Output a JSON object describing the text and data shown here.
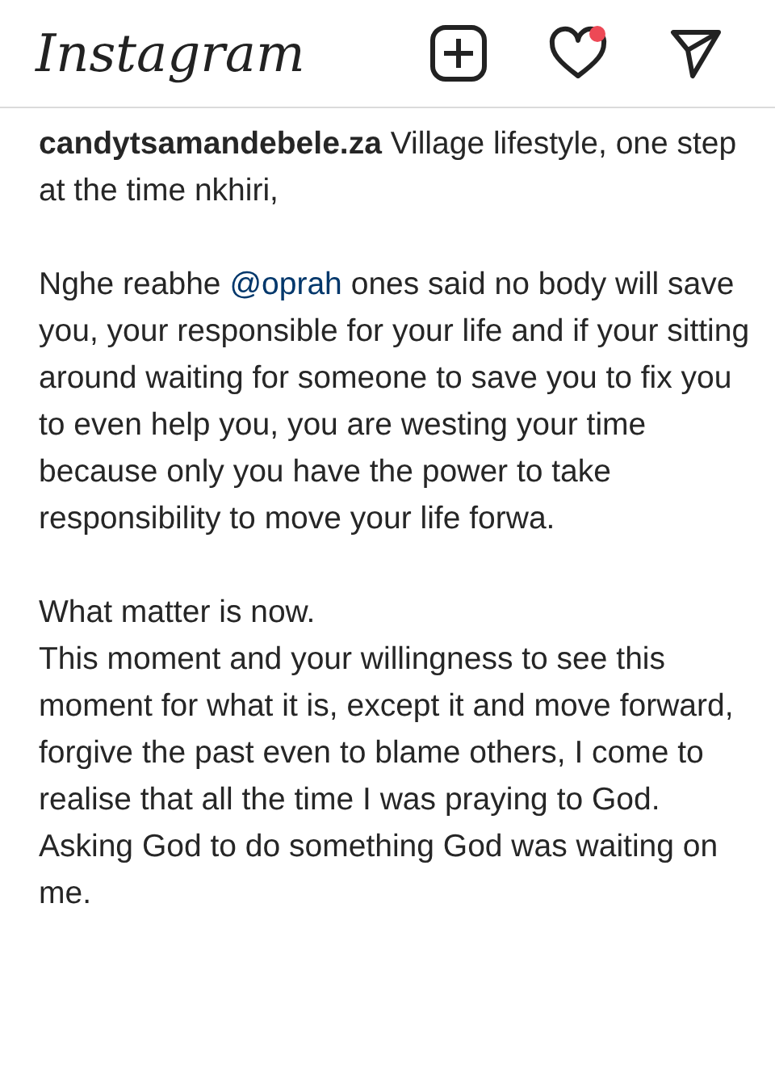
{
  "header": {
    "logo": "Instagram",
    "activity_notification": true
  },
  "caption": {
    "blocks": [
      [
        {
          "kind": "text",
          "text": "**candytsamandebele.za** Village lifestyle, one step at the time nkhiri,"
        }
      ],
      [
        {
          "kind": "mention",
          "before": "Nghe reabhe",
          "mention": "@oprah",
          "after": "ones said no body will save you, your responsible for your life and if your sitting around waiting for someone to save you to fix you to even help you, you are westing your time because only you have the power to take responsibility to move your life forwa."
        }
      ],
      [
        {
          "kind": "text",
          "text": "What matter is now."
        },
        {
          "kind": "text",
          "text": "This moment and your willingness to see this moment for what it is, except it and move forward, forgive the past even to blame others, I come to realise that all the time I was praying to God. Asking God to do something God was waiting on me."
        }
      ]
    ]
  }
}
